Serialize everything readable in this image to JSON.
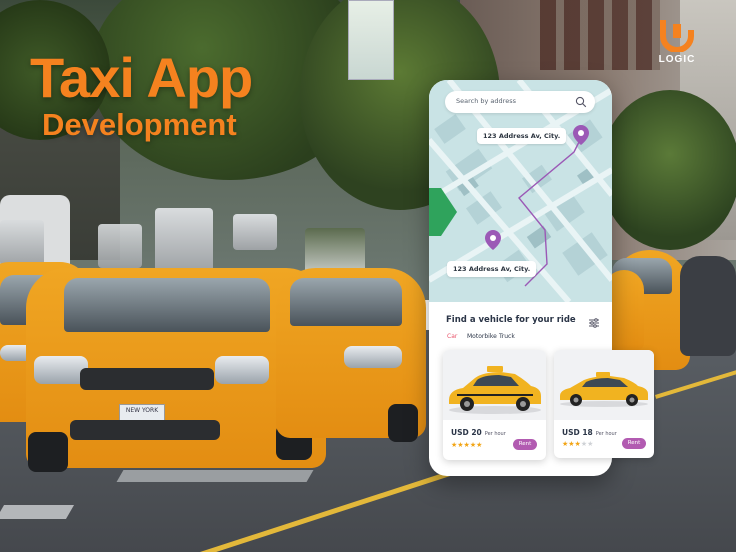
{
  "headline": {
    "line1": "Taxi App",
    "line2": "Development"
  },
  "logo": {
    "text": "LOGIC",
    "mark_color": "#f5821f"
  },
  "phone": {
    "search_placeholder": "Search by address",
    "pickup_label": "123 Address Av, City.",
    "dropoff_label": "123 Address Av, City.",
    "sheet_title": "Find a vehicle for your ride",
    "vehicle_tabs": [
      {
        "label": "Car",
        "active": true
      },
      {
        "label": "Motorbike",
        "active": false
      },
      {
        "label": "Truck",
        "active": false
      }
    ],
    "cards": [
      {
        "price": "USD 20",
        "per": "Per hour",
        "rating": 5,
        "rent_label": "Rent"
      },
      {
        "price": "USD 18",
        "per": "Per hour",
        "rating": 3,
        "rent_label": "Rent"
      }
    ]
  },
  "plate_text": "NEW YORK",
  "colors": {
    "accent": "#f5821f",
    "pin": "#9b59b6",
    "rent": "#b25bb1",
    "map_bg": "#c9e3e5",
    "star": "#f2a516"
  },
  "icons": [
    "search-icon",
    "location-pin-icon",
    "filter-icon",
    "star-icon",
    "logo-icon"
  ]
}
